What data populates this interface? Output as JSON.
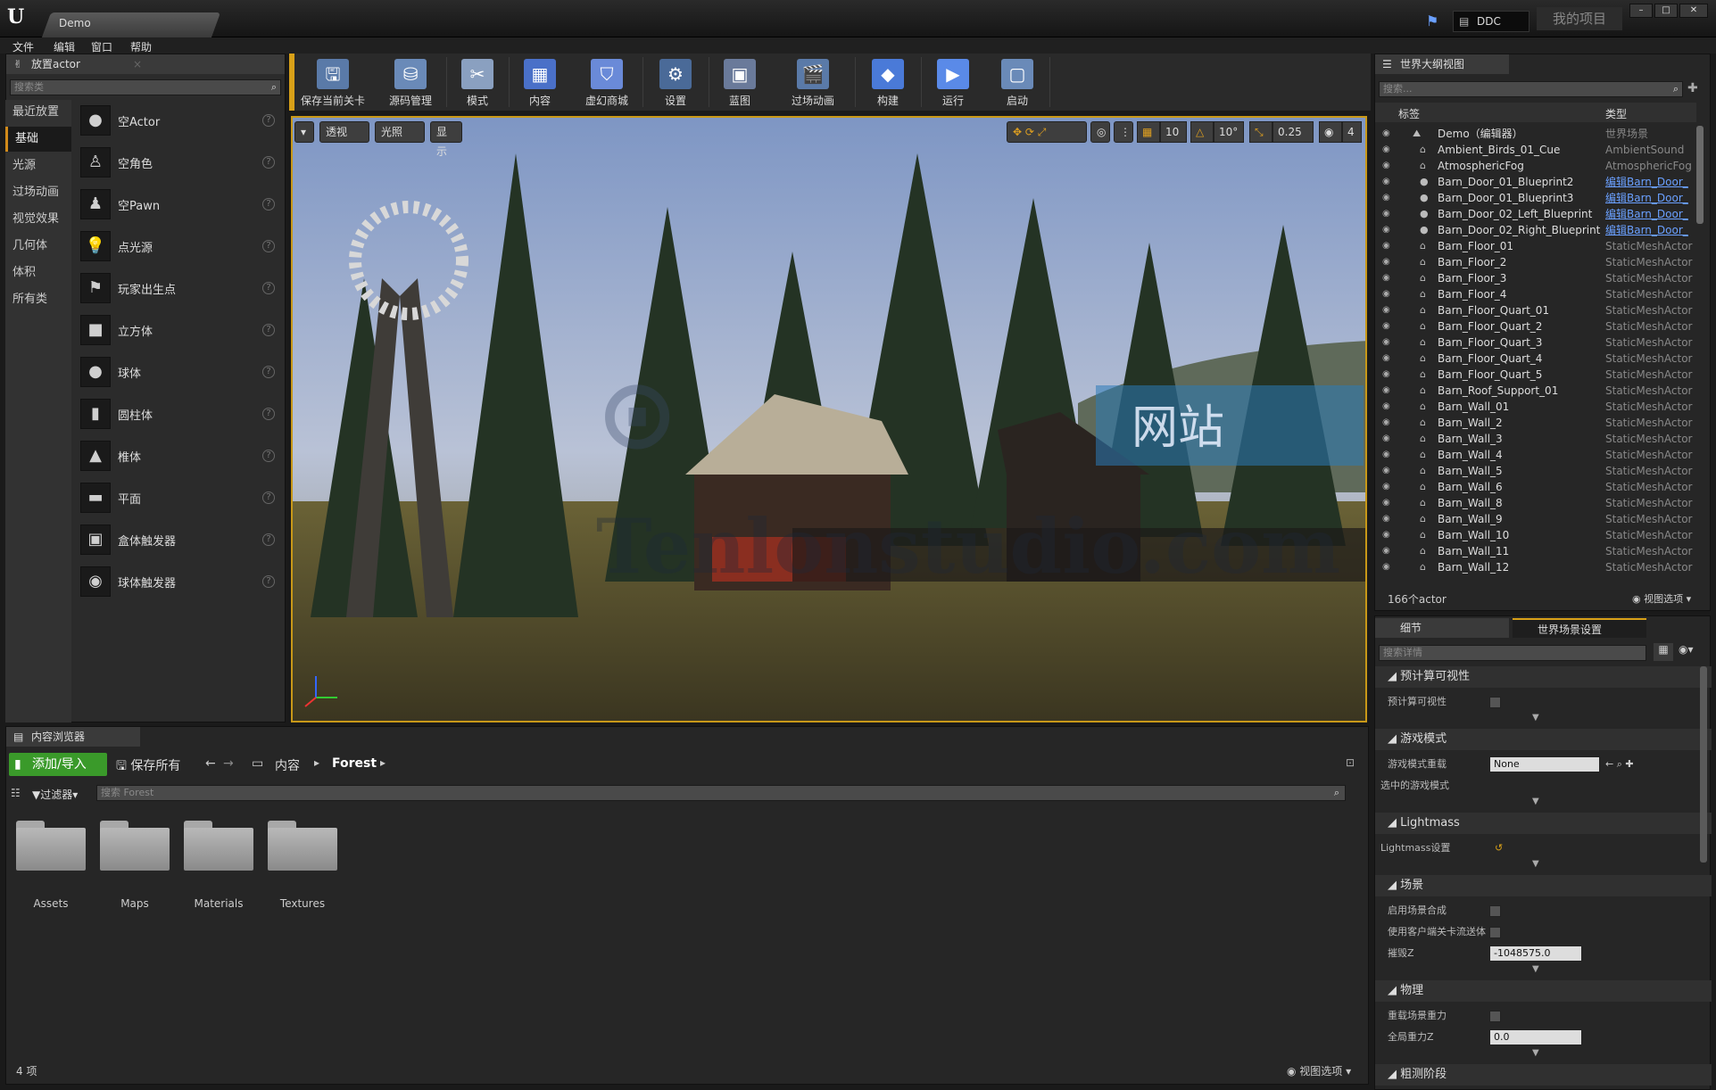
{
  "window": {
    "tab_title": "Demo",
    "ddc_label": "DDC",
    "project_name": "我的项目",
    "controls": [
      "–",
      "□",
      "✕"
    ]
  },
  "menu": [
    "文件",
    "编辑",
    "窗口",
    "帮助"
  ],
  "place_actor": {
    "tab_label": "放置actor",
    "search_placeholder": "搜索类",
    "categories": [
      "最近放置",
      "基础",
      "光源",
      "过场动画",
      "视觉效果",
      "几何体",
      "体积",
      "所有类"
    ],
    "selected_category": "基础",
    "items": [
      "空Actor",
      "空角色",
      "空Pawn",
      "点光源",
      "玩家出生点",
      "立方体",
      "球体",
      "圆柱体",
      "椎体",
      "平面",
      "盒体触发器",
      "球体触发器"
    ],
    "help_glyph": "?"
  },
  "toolbar": {
    "buttons": [
      "保存当前关卡",
      "源码管理",
      "模式",
      "内容",
      "虚幻商城",
      "设置",
      "蓝图",
      "过场动画",
      "构建",
      "运行",
      "启动"
    ]
  },
  "viewport": {
    "perspective_label": "透视",
    "lit_label": "光照",
    "show_label": "显示",
    "grid_snap": "10",
    "rotation_snap": "10°",
    "scale_snap": "0.25",
    "camera_speed": "4",
    "watermark_text_1": "网站",
    "watermark_text_2": "Tenlonstudio.com"
  },
  "outliner": {
    "tab_label": "世界大纲视图",
    "search_placeholder": "搜索...",
    "col_label": "标签",
    "col_type": "类型",
    "rows": [
      {
        "name": "Demo（编辑器）",
        "type": "世界场景",
        "link": false
      },
      {
        "name": "Ambient_Birds_01_Cue",
        "type": "AmbientSound",
        "link": false
      },
      {
        "name": "AtmosphericFog",
        "type": "AtmosphericFog",
        "link": false
      },
      {
        "name": "Barn_Door_01_Blueprint2",
        "type": "编辑Barn_Door_",
        "link": true
      },
      {
        "name": "Barn_Door_01_Blueprint3",
        "type": "编辑Barn_Door_",
        "link": true
      },
      {
        "name": "Barn_Door_02_Left_Blueprint",
        "type": "编辑Barn_Door_",
        "link": true
      },
      {
        "name": "Barn_Door_02_Right_Blueprint",
        "type": "编辑Barn_Door_",
        "link": true
      },
      {
        "name": "Barn_Floor_01",
        "type": "StaticMeshActor",
        "link": false
      },
      {
        "name": "Barn_Floor_2",
        "type": "StaticMeshActor",
        "link": false
      },
      {
        "name": "Barn_Floor_3",
        "type": "StaticMeshActor",
        "link": false
      },
      {
        "name": "Barn_Floor_4",
        "type": "StaticMeshActor",
        "link": false
      },
      {
        "name": "Barn_Floor_Quart_01",
        "type": "StaticMeshActor",
        "link": false
      },
      {
        "name": "Barn_Floor_Quart_2",
        "type": "StaticMeshActor",
        "link": false
      },
      {
        "name": "Barn_Floor_Quart_3",
        "type": "StaticMeshActor",
        "link": false
      },
      {
        "name": "Barn_Floor_Quart_4",
        "type": "StaticMeshActor",
        "link": false
      },
      {
        "name": "Barn_Floor_Quart_5",
        "type": "StaticMeshActor",
        "link": false
      },
      {
        "name": "Barn_Roof_Support_01",
        "type": "StaticMeshActor",
        "link": false
      },
      {
        "name": "Barn_Wall_01",
        "type": "StaticMeshActor",
        "link": false
      },
      {
        "name": "Barn_Wall_2",
        "type": "StaticMeshActor",
        "link": false
      },
      {
        "name": "Barn_Wall_3",
        "type": "StaticMeshActor",
        "link": false
      },
      {
        "name": "Barn_Wall_4",
        "type": "StaticMeshActor",
        "link": false
      },
      {
        "name": "Barn_Wall_5",
        "type": "StaticMeshActor",
        "link": false
      },
      {
        "name": "Barn_Wall_6",
        "type": "StaticMeshActor",
        "link": false
      },
      {
        "name": "Barn_Wall_8",
        "type": "StaticMeshActor",
        "link": false
      },
      {
        "name": "Barn_Wall_9",
        "type": "StaticMeshActor",
        "link": false
      },
      {
        "name": "Barn_Wall_10",
        "type": "StaticMeshActor",
        "link": false
      },
      {
        "name": "Barn_Wall_11",
        "type": "StaticMeshActor",
        "link": false
      },
      {
        "name": "Barn_Wall_12",
        "type": "StaticMeshActor",
        "link": false
      }
    ],
    "actor_count": "166个actor",
    "view_options": "视图选项"
  },
  "details": {
    "tab_details": "细节",
    "tab_world": "世界场景设置",
    "search_placeholder": "搜索详情",
    "sections": [
      {
        "title": "预计算可视性",
        "props": [
          {
            "name": "预计算可视性",
            "kind": "check"
          }
        ]
      },
      {
        "title": "游戏模式",
        "props": [
          {
            "name": "游戏模式重载",
            "kind": "select",
            "value": "None"
          },
          {
            "name": "选中的游戏模式",
            "kind": "expand"
          }
        ]
      },
      {
        "title": "Lightmass",
        "props": [
          {
            "name": "Lightmass设置",
            "kind": "expand"
          }
        ]
      },
      {
        "title": "场景",
        "props": [
          {
            "name": "启用场景合成",
            "kind": "check"
          },
          {
            "name": "使用客户端关卡流送体",
            "kind": "check"
          },
          {
            "name": "摧毁Z",
            "kind": "number",
            "value": "-1048575.0"
          }
        ]
      },
      {
        "title": "物理",
        "props": [
          {
            "name": "重载场景重力",
            "kind": "check"
          },
          {
            "name": "全局重力Z",
            "kind": "number",
            "value": "0.0"
          }
        ]
      },
      {
        "title": "粗测阶段",
        "props": []
      }
    ]
  },
  "content_browser": {
    "tab_label": "内容浏览器",
    "add_import": "添加/导入",
    "save_all": "保存所有",
    "path": [
      "内容",
      "Forest"
    ],
    "filter_label": "过滤器",
    "search_placeholder": "搜索 Forest",
    "folders": [
      "Assets",
      "Maps",
      "Materials",
      "Textures"
    ],
    "item_count": "4 项",
    "view_options": "视图选项"
  },
  "colors": {
    "accent": "#d8a018",
    "add_button": "#3a9a2a",
    "link": "#6aa0ff"
  }
}
